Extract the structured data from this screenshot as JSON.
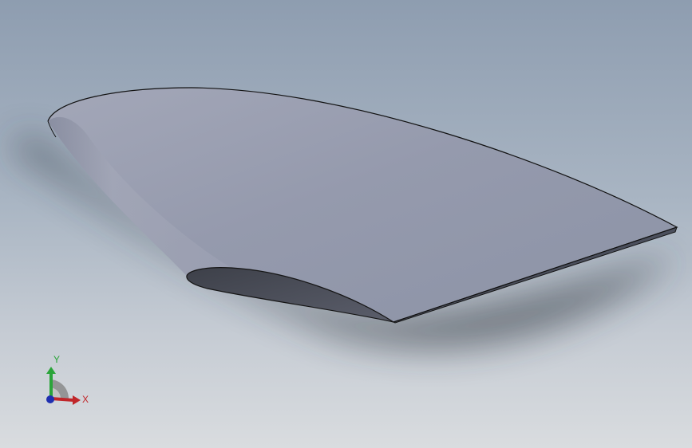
{
  "view": {
    "background_top": "#8e9db0",
    "background_bottom": "#d9dcdf",
    "model_face_color": "#9499ad",
    "model_edge_color": "#1a1a1a"
  },
  "triad": {
    "x_label": "X",
    "y_label": "Y",
    "x_color": "#c0262a",
    "y_color": "#2aa43a",
    "z_color": "#1f2fb0"
  }
}
